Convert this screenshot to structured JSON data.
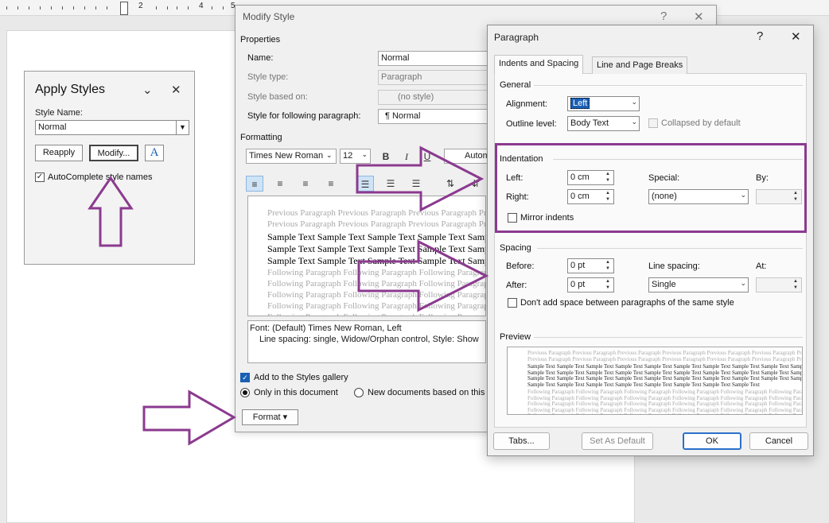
{
  "ruler": {
    "numbers": [
      "2",
      "4",
      "5"
    ]
  },
  "apply_styles": {
    "title": "Apply Styles",
    "style_name_label": "Style Name:",
    "style_name_value": "Normal",
    "reapply_label": "Reapply",
    "modify_label": "Modify...",
    "autocomplete_label": "AutoComplete style names"
  },
  "modify_style": {
    "title": "Modify Style",
    "help": "?",
    "close": "✕",
    "properties_label": "Properties",
    "name_label": "Name:",
    "name_value": "Normal",
    "style_type_label": "Style type:",
    "style_type_value": "Paragraph",
    "style_based_label": "Style based on:",
    "style_based_value": "(no style)",
    "following_label": "Style for following paragraph:",
    "following_value": "¶  Normal",
    "formatting_label": "Formatting",
    "font_value": "Times New Roman",
    "size_value": "12",
    "bold": "B",
    "italic": "I",
    "underline": "U",
    "color_value": "Autom",
    "preview_previous": "Previous Paragraph Previous Paragraph Previous Paragraph Previous Paragraph",
    "preview_sample": "Sample Text Sample Text Sample Text Sample Text Sample Text",
    "preview_following": "Following Paragraph Following Paragraph Following Paragraph Following",
    "description_line1": "Font: (Default) Times New Roman, Left",
    "description_line2": "Line spacing:  single, Widow/Orphan control, Style: Show",
    "add_gallery_label": "Add to the Styles gallery",
    "only_doc_label": "Only in this document",
    "new_docs_label": "New documents based on this",
    "format_label": "Format ▾"
  },
  "paragraph": {
    "title": "Paragraph",
    "help": "?",
    "close": "✕",
    "tab_indents": "Indents and Spacing",
    "tab_breaks": "Line and Page Breaks",
    "general_label": "General",
    "alignment_label": "Alignment:",
    "alignment_value": "Left",
    "outline_label": "Outline level:",
    "outline_value": "Body Text",
    "collapsed_label": "Collapsed by default",
    "indentation_label": "Indentation",
    "left_label": "Left:",
    "left_value": "0 cm",
    "right_label": "Right:",
    "right_value": "0 cm",
    "special_label": "Special:",
    "special_value": "(none)",
    "by_label": "By:",
    "mirror_label": "Mirror indents",
    "spacing_label": "Spacing",
    "before_label": "Before:",
    "before_value": "0 pt",
    "after_label": "After:",
    "after_value": "0 pt",
    "line_spacing_label": "Line spacing:",
    "line_spacing_value": "Single",
    "at_label": "At:",
    "dont_add_label": "Don't add space between paragraphs of the same style",
    "preview_label": "Preview",
    "preview_previous": "Previous Paragraph Previous Paragraph Previous Paragraph Previous Paragraph Previous Paragraph Previous Paragraph Previous",
    "preview_sample": "Sample Text Sample Text Sample Text Sample Text Sample Text Sample Text Sample Text Sample Text Sample Text Sample Text Sample Text",
    "preview_sample_last": "Sample Text Sample Text Sample Text Sample Text Sample Text Sample Text Sample Text Sample Text",
    "preview_following": "Following Paragraph Following Paragraph Following Paragraph Following Paragraph Following Paragraph Following Paragraph",
    "tabs_label": "Tabs...",
    "set_default_label": "Set As Default",
    "ok_label": "OK",
    "cancel_label": "Cancel"
  },
  "annotations": {
    "highlight_color": "#8b3a8f",
    "arrows": [
      "arrow-up",
      "arrow-right",
      "arrow-right",
      "arrow-right"
    ]
  }
}
